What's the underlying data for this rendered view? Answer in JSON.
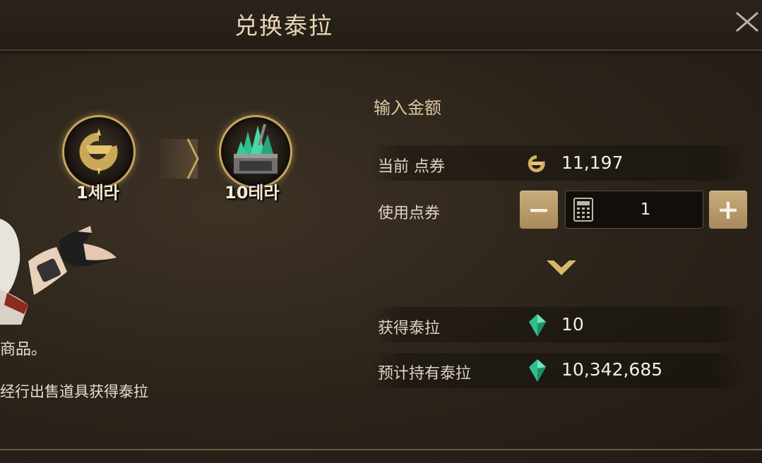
{
  "dialog": {
    "title": "兑换泰拉",
    "close_label": "×"
  },
  "exchange": {
    "from_label": "1세라",
    "to_label": "10테라"
  },
  "description": {
    "line1": "商品。",
    "line2": "经行出售道具获得泰拉"
  },
  "input_section": {
    "title": "输入金额",
    "current_points_label": "当前 点券",
    "current_points_value": "11,197",
    "use_points_label": "使用点券",
    "quantity": "1",
    "minus_label": "−",
    "plus_label": "+"
  },
  "result": {
    "gain_label": "获得泰拉",
    "gain_value": "10",
    "expected_label": "预计持有泰拉",
    "expected_value": "10,342,685"
  },
  "icons": [
    "close-icon",
    "cera-coin-icon",
    "tera-crystal-icon",
    "arrow-right-icon",
    "calculator-icon",
    "chevron-down-icon",
    "gem-icon"
  ],
  "colors": {
    "accent_gold": "#c8a45e",
    "button": "#b89a68",
    "title": "#e9d7b4",
    "gem": "#2fbf8f"
  }
}
